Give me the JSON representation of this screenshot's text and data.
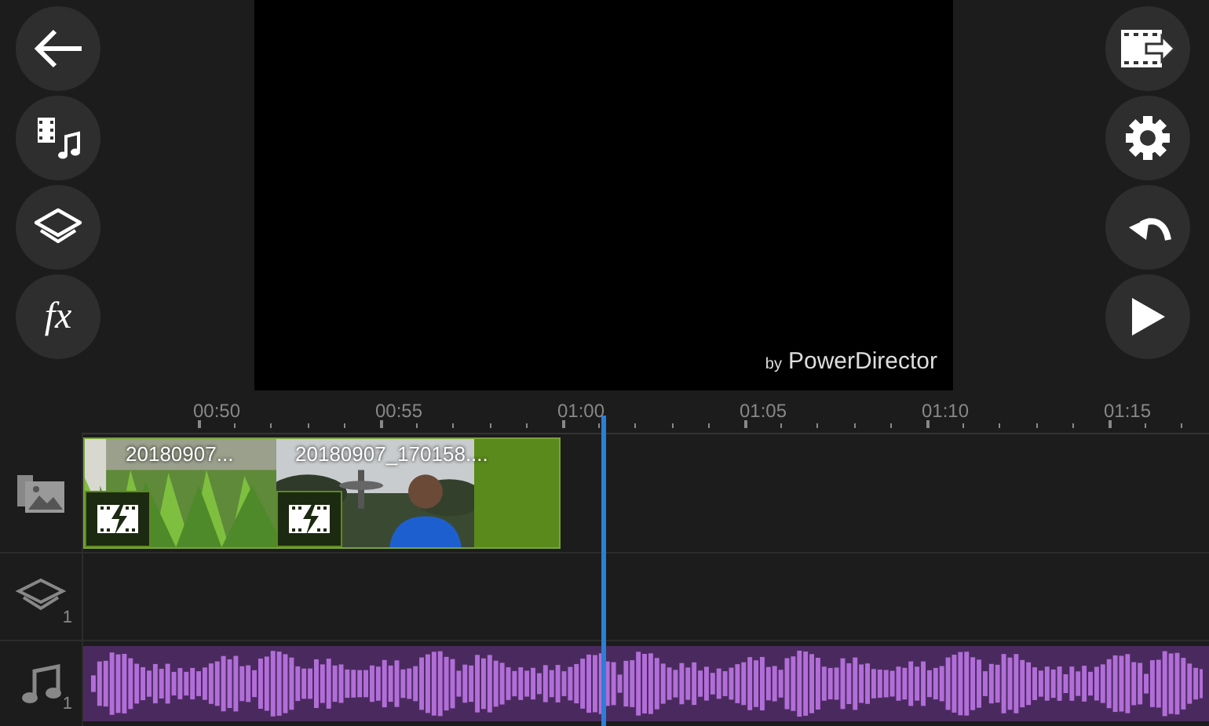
{
  "left_toolbar": [
    {
      "kind": "back"
    },
    {
      "kind": "media"
    },
    {
      "kind": "layers"
    },
    {
      "kind": "fx",
      "label": "fx"
    }
  ],
  "preview": {
    "watermark_prefix": "by",
    "watermark_brand": "PowerDirector"
  },
  "right_toolbar": [
    {
      "kind": "export"
    },
    {
      "kind": "settings"
    },
    {
      "kind": "undo"
    },
    {
      "kind": "play"
    }
  ],
  "ruler": {
    "ticks": [
      "00:50",
      "00:55",
      "01:00",
      "01:05",
      "01:10",
      "01:15"
    ]
  },
  "tracks": [
    {
      "kind": "video",
      "clips": [
        {
          "label": "20180907...",
          "kind": "grass"
        },
        {
          "label": "20180907_170158....",
          "kind": "park"
        }
      ]
    },
    {
      "kind": "overlay",
      "count": "1"
    },
    {
      "kind": "audio",
      "count": "1"
    }
  ]
}
